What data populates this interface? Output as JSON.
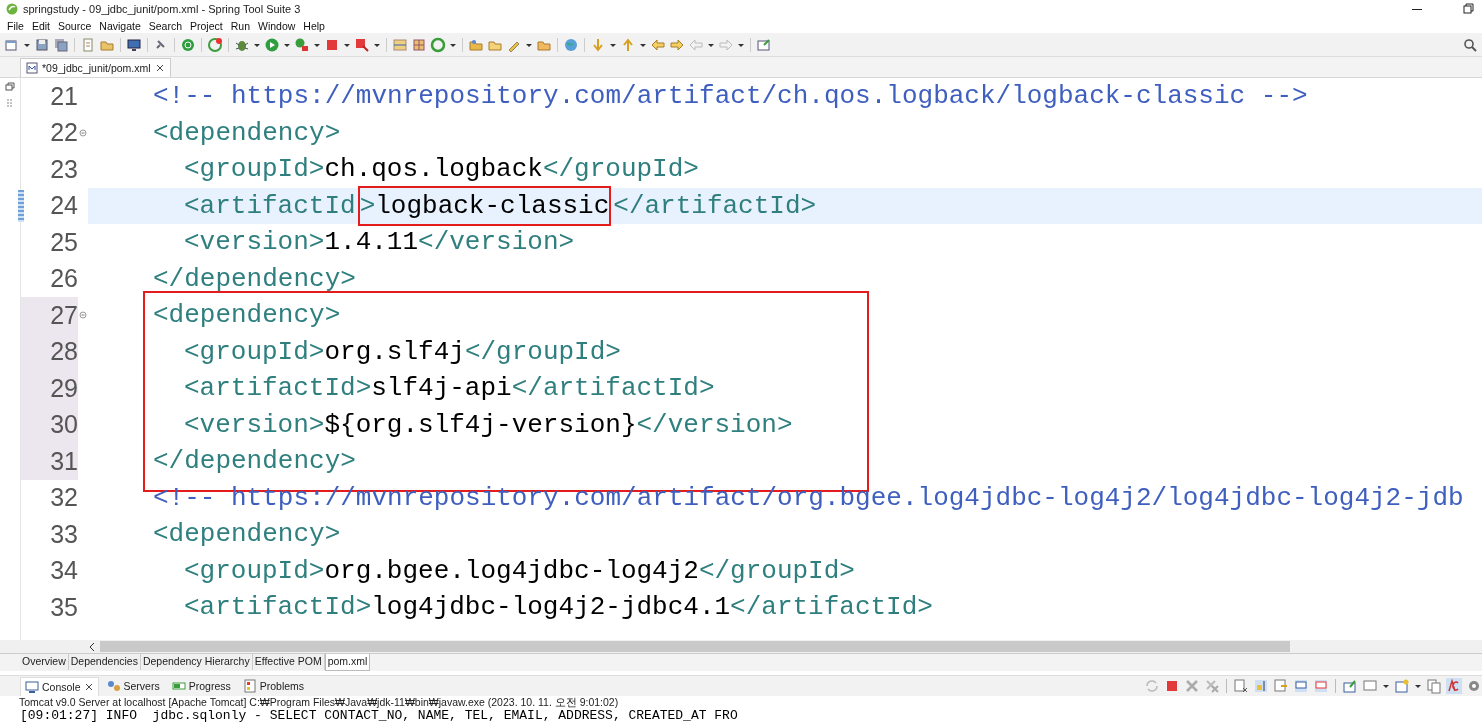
{
  "window": {
    "title": "springstudy - 09_jdbc_junit/pom.xml - Spring Tool Suite 3"
  },
  "menu": [
    "File",
    "Edit",
    "Source",
    "Navigate",
    "Search",
    "Project",
    "Run",
    "Window",
    "Help"
  ],
  "editor_tabs": [
    {
      "label": "*09_jdbc_junit/pom.xml",
      "selected": true
    }
  ],
  "editor": {
    "lines": [
      {
        "number": "21",
        "current": false,
        "foldable": false,
        "changed": false,
        "boxed": false,
        "tokens": [
          {
            "kind": "comment",
            "text": "<!-- https://mvnrepository.com/artifact/ch.qos.logback/logback-classic -->"
          }
        ]
      },
      {
        "number": "22",
        "current": false,
        "foldable": true,
        "changed": false,
        "boxed": false,
        "tokens": [
          {
            "kind": "tag",
            "text": "<dependency>"
          }
        ],
        "children": [
          {
            "number": "23",
            "current": false,
            "foldable": false,
            "changed": false,
            "boxed": false,
            "tokens": [
              {
                "kind": "tag",
                "text": "<groupId>"
              },
              {
                "kind": "text",
                "text": "ch.qos.logback"
              },
              {
                "kind": "tag",
                "text": "</groupId>"
              }
            ]
          },
          {
            "number": "24",
            "current": true,
            "foldable": false,
            "changed": false,
            "boxed": false,
            "tokens": [
              {
                "kind": "tag",
                "text": "<artifactId",
                "boxed": false
              },
              {
                "kind": "tag",
                "text": ">",
                "boxed": true
              },
              {
                "kind": "text",
                "text": "logback-classic",
                "boxed": true
              },
              {
                "kind": "tag",
                "text": "</artifactId>",
                "boxed": false
              }
            ]
          },
          {
            "number": "25",
            "current": false,
            "foldable": false,
            "changed": false,
            "boxed": false,
            "tokens": [
              {
                "kind": "tag",
                "text": "<version>"
              },
              {
                "kind": "text",
                "text": "1.4.11"
              },
              {
                "kind": "tag",
                "text": "</version>"
              }
            ]
          }
        ]
      },
      {
        "number": "26",
        "current": false,
        "foldable": false,
        "changed": false,
        "boxed": false,
        "tokens": [
          {
            "kind": "tag",
            "text": "</dependency>"
          }
        ]
      },
      {
        "number": "27",
        "current": false,
        "foldable": true,
        "changed": true,
        "boxed": true,
        "tokens": [
          {
            "kind": "tag",
            "text": "<dependency>"
          }
        ],
        "children": [
          {
            "number": "28",
            "current": false,
            "foldable": false,
            "changed": true,
            "boxed": true,
            "tokens": [
              {
                "kind": "tag",
                "text": "<groupId>"
              },
              {
                "kind": "text",
                "text": "org.slf4j"
              },
              {
                "kind": "tag",
                "text": "</groupId>"
              }
            ]
          },
          {
            "number": "29",
            "current": false,
            "foldable": false,
            "changed": true,
            "boxed": true,
            "tokens": [
              {
                "kind": "tag",
                "text": "<artifactId>"
              },
              {
                "kind": "text",
                "text": "slf4j-api"
              },
              {
                "kind": "tag",
                "text": "</artifactId>"
              }
            ]
          },
          {
            "number": "30",
            "current": false,
            "foldable": false,
            "changed": true,
            "boxed": true,
            "tokens": [
              {
                "kind": "tag",
                "text": "<version>"
              },
              {
                "kind": "text",
                "text": "${org.slf4j-version}"
              },
              {
                "kind": "tag",
                "text": "</version>"
              }
            ]
          }
        ]
      },
      {
        "number": "31",
        "current": false,
        "foldable": false,
        "changed": true,
        "boxed": true,
        "tokens": [
          {
            "kind": "tag",
            "text": "</dependency>"
          }
        ]
      },
      {
        "number": "32",
        "current": false,
        "foldable": false,
        "changed": false,
        "boxed": false,
        "tokens": [
          {
            "kind": "comment",
            "text": "<!-- https://mvnrepository.com/artifact/org.bgee.log4jdbc-log4j2/log4jdbc-log4j2-jdb"
          }
        ]
      },
      {
        "number": "33",
        "current": false,
        "foldable": false,
        "changed": false,
        "boxed": false,
        "tokens": [
          {
            "kind": "tag",
            "text": "<dependency>"
          }
        ],
        "children": [
          {
            "number": "34",
            "current": false,
            "foldable": false,
            "changed": false,
            "boxed": false,
            "tokens": [
              {
                "kind": "tag",
                "text": "<groupId>"
              },
              {
                "kind": "text",
                "text": "org.bgee.log4jdbc-log4j2"
              },
              {
                "kind": "tag",
                "text": "</groupId>"
              }
            ]
          },
          {
            "number": "35",
            "current": false,
            "foldable": false,
            "changed": false,
            "boxed": false,
            "tokens": [
              {
                "kind": "tag",
                "text": "<artifactId>"
              },
              {
                "kind": "text",
                "text": "log4jdbc-log4j2-jdbc4.1"
              },
              {
                "kind": "tag",
                "text": "</artifactId>"
              }
            ]
          }
        ]
      }
    ]
  },
  "page_tabs": [
    {
      "label": "Overview",
      "selected": false
    },
    {
      "label": "Dependencies",
      "selected": false
    },
    {
      "label": "Dependency Hierarchy",
      "selected": false
    },
    {
      "label": "Effective POM",
      "selected": false
    },
    {
      "label": "pom.xml",
      "selected": true
    }
  ],
  "console": {
    "tabs": [
      {
        "label": "Console",
        "selected": true
      },
      {
        "label": "Servers",
        "selected": false
      },
      {
        "label": "Progress",
        "selected": false
      },
      {
        "label": "Problems",
        "selected": false
      }
    ],
    "description": "Tomcat v9.0 Server at localhost [Apache Tomcat] C:₩Program Files₩Java₩jdk-11₩bin₩javaw.exe  (2023. 10. 11. 오전 9:01:02)",
    "output": "[09:01:27] INFO  jdbc.sqlonly - SELECT CONTACT_NO, NAME, TEL, EMAIL, ADDRESS, CREATED_AT FRO"
  }
}
